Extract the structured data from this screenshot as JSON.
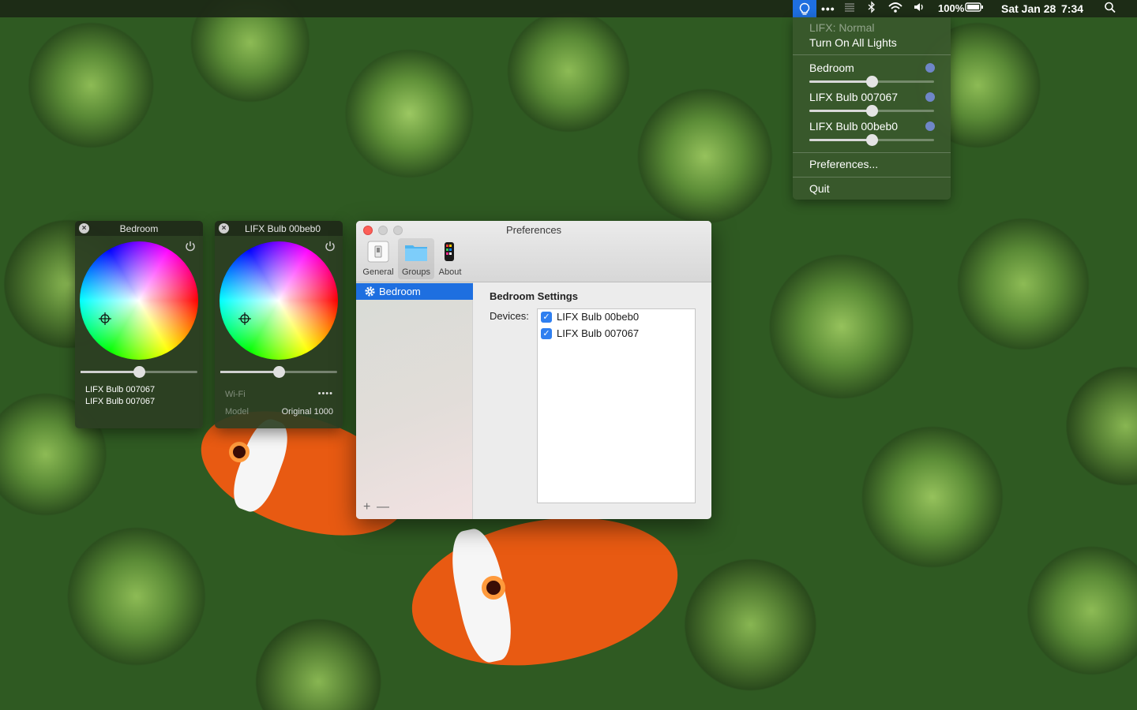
{
  "menubar": {
    "lifx_icon": "lifx-bulb-icon",
    "more_icon": "ellipsis-icon",
    "dots": "•••",
    "battery_percent": "100%",
    "date": "Sat Jan 28",
    "time": "7:34"
  },
  "dropdown": {
    "status": "LIFX: Normal",
    "turn_on_all": "Turn On All Lights",
    "lights": [
      {
        "label": "Bedroom",
        "brightness": 0.5
      },
      {
        "label": "LIFX Bulb 007067",
        "brightness": 0.5
      },
      {
        "label": "LIFX Bulb 00beb0",
        "brightness": 0.5
      }
    ],
    "preferences": "Preferences...",
    "quit": "Quit"
  },
  "hud_bedroom": {
    "title": "Bedroom",
    "brightness": 0.5,
    "line1": "LIFX Bulb 007067",
    "line2": "LIFX Bulb 007067"
  },
  "hud_bulb": {
    "title": "LIFX Bulb 00beb0",
    "brightness": 0.5,
    "wifi_label": "Wi-Fi",
    "wifi_value": "••••",
    "model_label": "Model",
    "model_value": "Original 1000"
  },
  "prefs": {
    "title": "Preferences",
    "toolbar": [
      {
        "label": "General"
      },
      {
        "label": "Groups"
      },
      {
        "label": "About"
      }
    ],
    "sidebar_items": [
      {
        "label": "Bedroom"
      }
    ],
    "add": "+",
    "remove": "—",
    "settings_heading": "Bedroom Settings",
    "devices_label": "Devices:",
    "devices": [
      {
        "name": "LIFX Bulb 00beb0",
        "checked": true
      },
      {
        "name": "LIFX Bulb 007067",
        "checked": true
      }
    ]
  },
  "colors": {
    "accent": "#1e6fe0",
    "close_red": "#fc5f57",
    "light_dot": "#6f86c8"
  }
}
